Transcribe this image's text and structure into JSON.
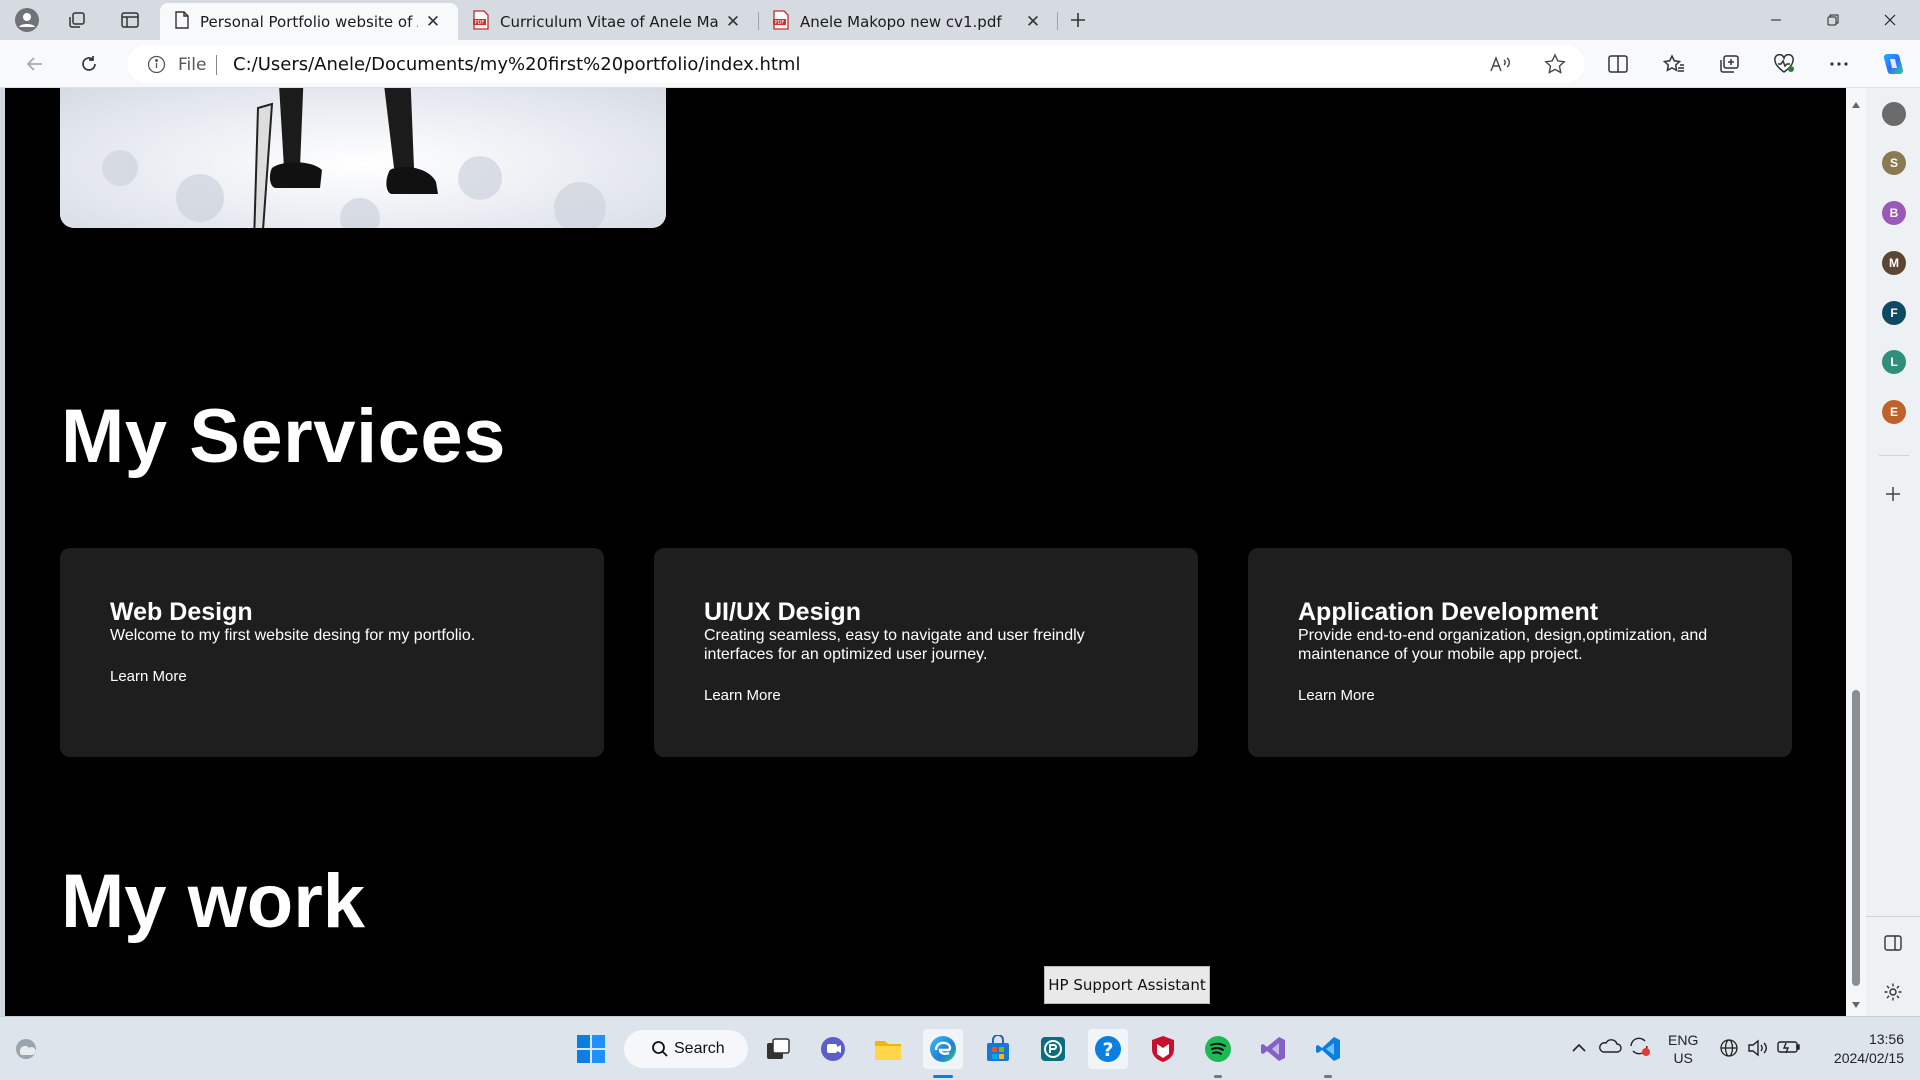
{
  "browser": {
    "tabs": [
      {
        "title": "Personal Portfolio website of A.M",
        "active": true
      },
      {
        "title": "Curriculum Vitae of Anele Makopo",
        "active": false
      },
      {
        "title": "Anele Makopo new cv1.pdf",
        "active": false
      }
    ],
    "address": {
      "protocol_label": "File",
      "url": "C:/Users/Anele/Documents/my%20first%20portfolio/index.html"
    },
    "sidebar_avatars": [
      {
        "letter": "",
        "color": "#6b6b6b"
      },
      {
        "letter": "S",
        "color": "#8a7a52"
      },
      {
        "letter": "B",
        "color": "#9b59b6"
      },
      {
        "letter": "M",
        "color": "#5a4632"
      },
      {
        "letter": "F",
        "color": "#0e4a63"
      },
      {
        "letter": "L",
        "color": "#2f8f7a"
      },
      {
        "letter": "E",
        "color": "#c0602a"
      }
    ]
  },
  "page": {
    "services_heading": "My Services",
    "services": [
      {
        "title": "Web Design",
        "description": "Welcome to my first website desing for my portfolio.",
        "link": "Learn More"
      },
      {
        "title": "UI/UX Design",
        "description": "Creating seamless, easy to navigate and user freindly interfaces for an optimized user journey.",
        "link": "Learn More"
      },
      {
        "title": "Application Development",
        "description": "Provide end-to-end organization, design,optimization, and maintenance of your mobile app project.",
        "link": "Learn More"
      }
    ],
    "work_heading": "My work"
  },
  "tooltip": "HP Support Assistant",
  "taskbar": {
    "search_label": "Search",
    "language": "ENG",
    "region": "US",
    "time": "13:56",
    "date": "2024/02/15"
  },
  "colors": {
    "page_bg": "#000000",
    "card_bg": "#1f1e1e",
    "accent": "#0078d4"
  }
}
